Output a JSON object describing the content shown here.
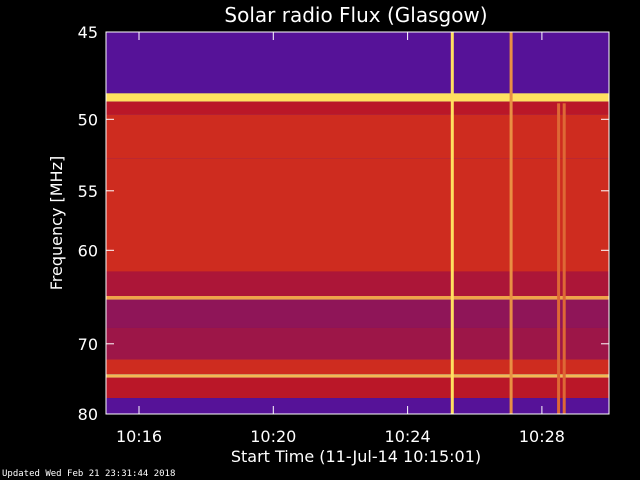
{
  "colors": {
    "background": "#000000",
    "text": "#ffffff",
    "spectrogram_low": "#3a10b8",
    "spectrogram_mid": "#c81818",
    "spectrogram_high": "#ffe060"
  },
  "chart_data": {
    "type": "heatmap",
    "title": "Solar radio Flux (Glasgow)",
    "ylabel": "Frequency [MHz]",
    "xlabel": "Start Time (11-Jul-14 10:15:01)",
    "ylim": [
      45,
      80
    ],
    "y_scale": "reciprocal",
    "xlim": [
      "10:15:01",
      "10:30:00"
    ],
    "y_ticks": [
      {
        "value": 45,
        "label": "45"
      },
      {
        "value": 50,
        "label": "50"
      },
      {
        "value": 55,
        "label": "55"
      },
      {
        "value": 60,
        "label": "60"
      },
      {
        "value": 70,
        "label": "70"
      },
      {
        "value": 80,
        "label": "80"
      }
    ],
    "x_ticks": [
      {
        "value": "10:16",
        "label": "10:16"
      },
      {
        "value": "10:20",
        "label": "10:20"
      },
      {
        "value": "10:24",
        "label": "10:24"
      },
      {
        "value": "10:28",
        "label": "10:28"
      }
    ],
    "bands": [
      {
        "mhz": [
          45,
          48.4
        ],
        "level": 0.1
      },
      {
        "mhz": [
          48.4,
          48.9
        ],
        "level": 1.0
      },
      {
        "mhz": [
          48.9,
          49.7
        ],
        "level": 0.45
      },
      {
        "mhz": [
          49.7,
          52.6
        ],
        "level": 0.55
      },
      {
        "mhz": [
          52.6,
          62.0
        ],
        "level": 0.55
      },
      {
        "mhz": [
          62.0,
          64.5
        ],
        "level": 0.4
      },
      {
        "mhz": [
          64.5,
          64.9
        ],
        "level": 0.85
      },
      {
        "mhz": [
          64.9,
          68.0
        ],
        "level": 0.3
      },
      {
        "mhz": [
          68.0,
          72.0
        ],
        "level": 0.35
      },
      {
        "mhz": [
          72.0,
          74.0
        ],
        "level": 0.55
      },
      {
        "mhz": [
          74.0,
          74.5
        ],
        "level": 0.9
      },
      {
        "mhz": [
          74.5,
          77.5
        ],
        "level": 0.45
      },
      {
        "mhz": [
          77.5,
          80.0
        ],
        "level": 0.1
      }
    ],
    "bursts": [
      {
        "time": "10:25:20",
        "mhz": [
          45,
          80
        ],
        "level": 1.0
      },
      {
        "time": "10:27:05",
        "mhz": [
          45,
          80
        ],
        "level": 0.8
      },
      {
        "time": "10:28:30",
        "mhz": [
          49,
          80
        ],
        "level": 0.7
      },
      {
        "time": "10:28:40",
        "mhz": [
          49,
          80
        ],
        "level": 0.7
      }
    ]
  },
  "footer": {
    "text": "Updated Wed Feb 21 23:31:44 2018"
  }
}
